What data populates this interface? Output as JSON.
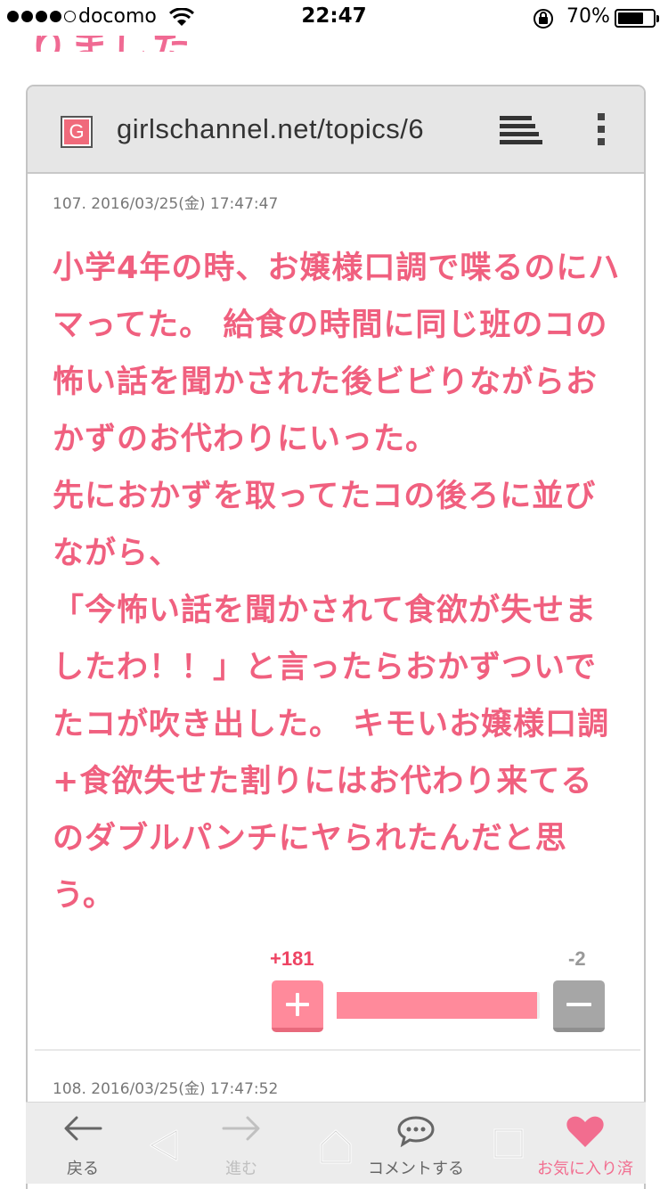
{
  "status_bar": {
    "carrier": "docomo",
    "time": "22:47",
    "battery_percent": "70%"
  },
  "heading_fragment": "りました",
  "browser": {
    "favicon_letter": "G",
    "url": "girlschannel.net/topics/6"
  },
  "comments": [
    {
      "number_date": "107.  2016/03/25(金) 17:47:47",
      "body": "小学4年の時、お嬢様口調で喋るのにハマってた。 給食の時間に同じ班のコの怖い話を聞かされた後ビビりながらおかずのお代わりにいった。\n先におかずを取ってたコの後ろに並びながら、\n「今怖い話を聞かされて食欲が失せましたわ！！」と言ったらおかずついでたコが吹き出した。 キモいお嬢様口調+食欲失せた割りにはお代わり来てるのダブルパンチにヤられたんだと思う。",
      "plus_count": "+181",
      "minus_count": "-2",
      "plus_fraction": 0.989
    },
    {
      "number_date": "108.  2016/03/25(金) 17:47:52"
    }
  ],
  "toolbar": {
    "back_label": "戻る",
    "forward_label": "進む",
    "comment_label": "コメントする",
    "favorite_label": "お気に入り済"
  },
  "colors": {
    "accent_pink": "#f0607f",
    "plus_pink": "#ff8a9b",
    "minus_gray": "#a6a6a6"
  }
}
